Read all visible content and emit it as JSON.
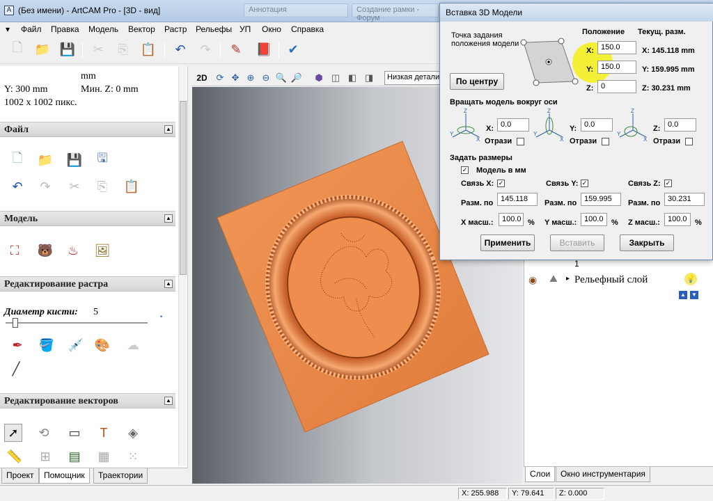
{
  "window": {
    "title": "(Без имени) - ArtCAM Pro - [3D - вид]",
    "bg_tabs": [
      "Аннотация",
      "Создание рамки - Форум"
    ]
  },
  "menu": [
    "Файл",
    "Правка",
    "Модель",
    "Вектор",
    "Растр",
    "Рельефы",
    "УП",
    "Окно",
    "Справка"
  ],
  "left_panel": {
    "unit_label": "mm",
    "y_size": "Y: 300 mm",
    "min_z": "Мин. Z: 0 mm",
    "pixels": "1002 x 1002 пикс.",
    "sections": {
      "file": "Файл",
      "model": "Модель",
      "raster": "Редактирование растра",
      "vectors": "Редактирование векторов"
    },
    "brush_label": "Диаметр кисти:",
    "brush_value": "5",
    "brush_level": 0.05,
    "tabs": [
      "Проект",
      "Помощник",
      "Траектории"
    ]
  },
  "view_toolbar": {
    "mode_2d": "2D",
    "detail_level": "Низкая детализация"
  },
  "layers": {
    "relief_layer": "Рельефный слой",
    "tabs": [
      "Слои",
      "Окно инструментария"
    ]
  },
  "status": {
    "x": "X: 255.988",
    "y": "Y: 79.641",
    "z": "Z: 0.000"
  },
  "dialog": {
    "title": "Вставка 3D Модели",
    "anchor_label": "Точка задания положения модели",
    "center_button": "По центру",
    "position_header": "Положение",
    "current_size_header": "Текущ. разм.",
    "pos_x_label": "X:",
    "pos_y_label": "Y:",
    "pos_z_label": "Z:",
    "pos_x": "150.0",
    "pos_y": "150.0",
    "pos_z": "0",
    "cur_x": "X: 145.118 mm",
    "cur_y": "Y: 159.995 mm",
    "cur_z": "Z: 30.231 mm",
    "rotate_header": "Вращать модель вокруг оси",
    "rot_x_label": "X:",
    "rot_y_label": "Y:",
    "rot_z_label": "Z:",
    "rot_x": "0.0",
    "rot_y": "0.0",
    "rot_z": "0.0",
    "mirror_label": "Отрази",
    "size_header": "Задать размеры",
    "model_in_mm": "Модель в мм",
    "link_x": "Связь X:",
    "link_y": "Связь Y:",
    "link_z": "Связь Z:",
    "size_by": "Разм. по",
    "size_x": "145.118",
    "size_y": "159.995",
    "size_z": "30.231",
    "scale_x_label": "X масш.:",
    "scale_y_label": "Y масш.:",
    "scale_z_label": "Z масш.:",
    "scale_x": "100.0",
    "scale_y": "100.0",
    "scale_z": "100.0",
    "percent": "%",
    "apply": "Применить",
    "insert": "Вставить",
    "close": "Закрыть"
  },
  "colors": {
    "relief_orange": "#e8874a",
    "highlight": "#f5f014",
    "title_bar": "#c3d5ec"
  }
}
